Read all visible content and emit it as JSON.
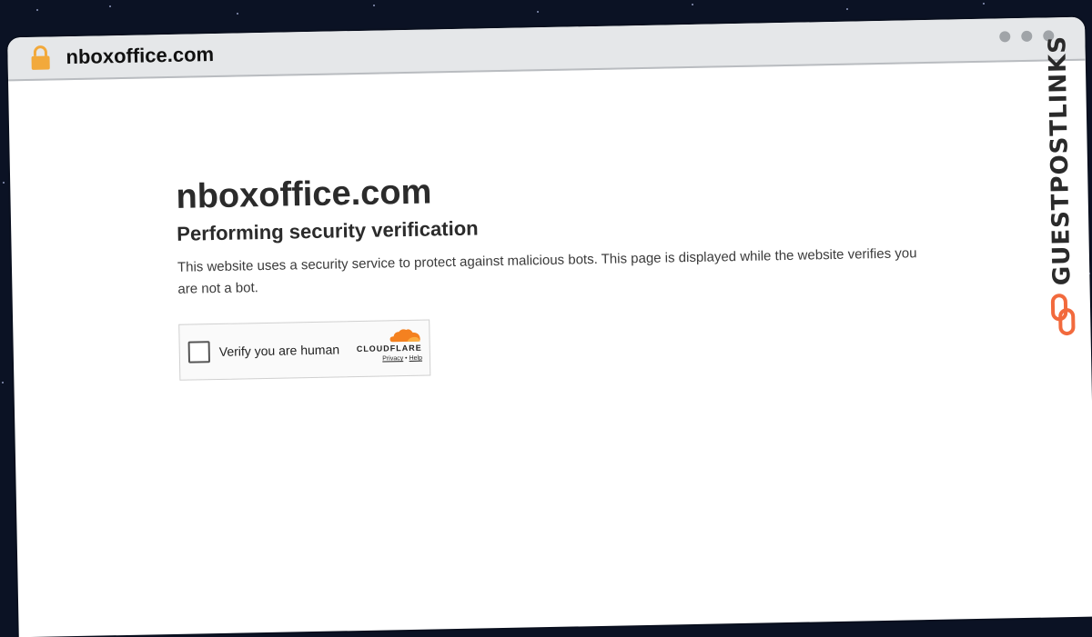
{
  "browser": {
    "url": "nboxoffice.com",
    "lock_icon": "lock-icon",
    "accent_lock": "#f2a93b"
  },
  "page": {
    "site_title": "nboxoffice.com",
    "heading": "Performing security verification",
    "description": "This website uses a security service to protect against malicious bots. This page is displayed while the website verifies you are not a bot."
  },
  "challenge": {
    "checkbox_label": "Verify you are human",
    "checked": false,
    "provider": "CLOUDFLARE",
    "privacy_label": "Privacy",
    "separator": "•",
    "help_label": "Help",
    "cloud_color": "#f48120"
  },
  "watermark": {
    "brand": "GUESTPOSTLINKS",
    "brand_color": "#2a2a2a",
    "link_icon_color": "#f26a3d"
  }
}
